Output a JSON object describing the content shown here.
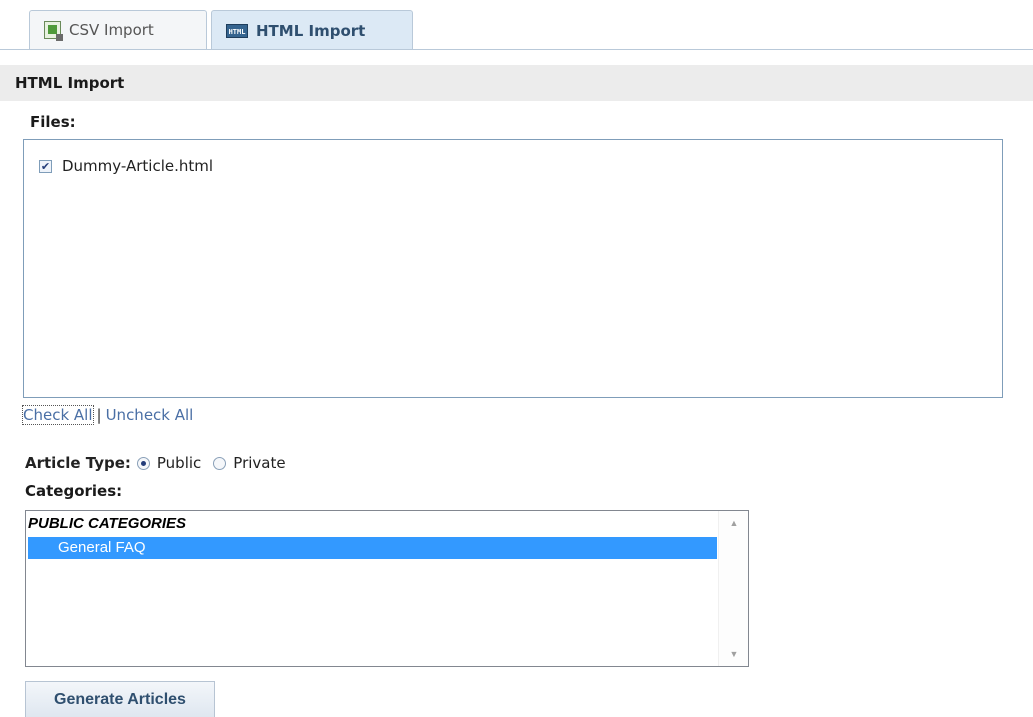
{
  "tabs": [
    {
      "label": "CSV Import",
      "icon": "csv-file-icon",
      "active": false
    },
    {
      "label": "HTML Import",
      "icon": "html-file-icon",
      "active": true
    }
  ],
  "html_icon_text": "HTML",
  "section": {
    "title": "HTML Import"
  },
  "files": {
    "label": "Files:",
    "items": [
      {
        "name": "Dummy-Article.html",
        "checked": true
      }
    ]
  },
  "links": {
    "check_all": "Check All",
    "separator": "|",
    "uncheck_all": "Uncheck All"
  },
  "article_type": {
    "label": "Article Type:",
    "options": [
      {
        "label": "Public",
        "selected": true
      },
      {
        "label": "Private",
        "selected": false
      }
    ]
  },
  "categories": {
    "label": "Categories:",
    "group": "PUBLIC CATEGORIES",
    "items": [
      {
        "label": "General FAQ",
        "selected": true
      }
    ]
  },
  "button": {
    "generate": "Generate Articles"
  },
  "colors": {
    "selection": "#3399ff",
    "link": "#4a6fa5",
    "active_tab": "#dce9f5"
  }
}
